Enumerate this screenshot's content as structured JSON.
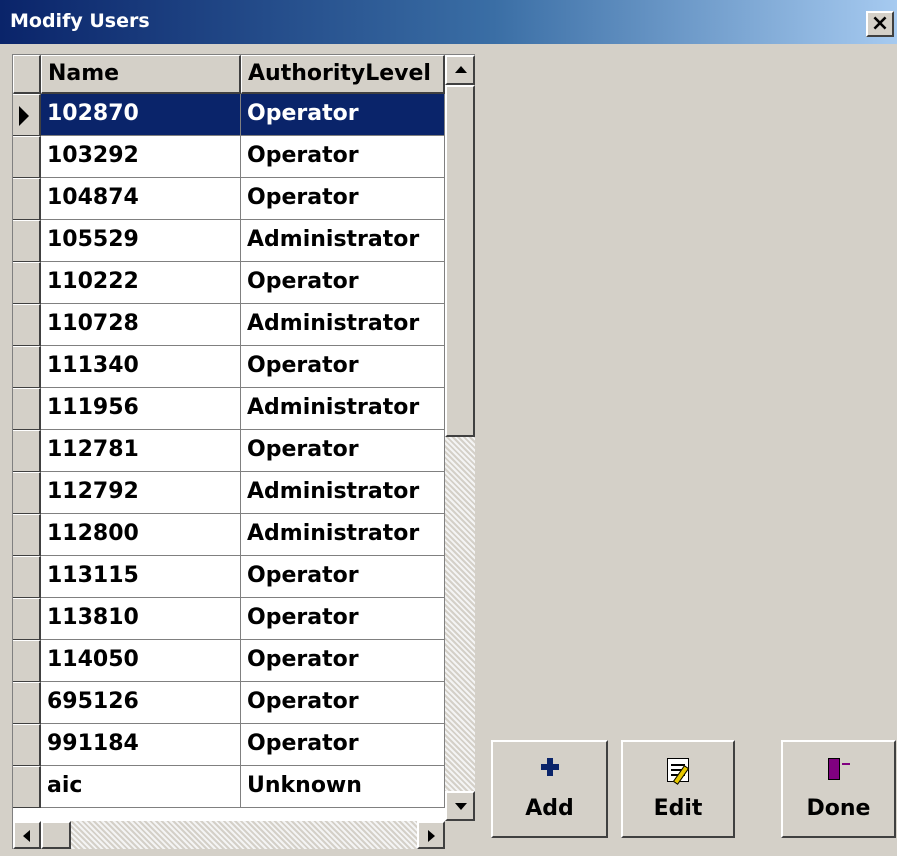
{
  "window": {
    "title": "Modify Users",
    "close_symbol": "×"
  },
  "table": {
    "columns": [
      "Name",
      "AuthorityLevel"
    ],
    "selected_row": 0,
    "rows": [
      {
        "name": "102870",
        "authority": "Operator"
      },
      {
        "name": "103292",
        "authority": "Operator"
      },
      {
        "name": "104874",
        "authority": "Operator"
      },
      {
        "name": "105529",
        "authority": "Administrator"
      },
      {
        "name": "110222",
        "authority": "Operator"
      },
      {
        "name": "110728",
        "authority": "Administrator"
      },
      {
        "name": "111340",
        "authority": "Operator"
      },
      {
        "name": "111956",
        "authority": "Administrator"
      },
      {
        "name": "112781",
        "authority": "Operator"
      },
      {
        "name": "112792",
        "authority": "Administrator"
      },
      {
        "name": "112800",
        "authority": "Administrator"
      },
      {
        "name": "113115",
        "authority": "Operator"
      },
      {
        "name": "113810",
        "authority": "Operator"
      },
      {
        "name": "114050",
        "authority": "Operator"
      },
      {
        "name": "695126",
        "authority": "Operator"
      },
      {
        "name": "991184",
        "authority": "Operator"
      },
      {
        "name": "aic",
        "authority": "Unknown"
      }
    ]
  },
  "buttons": {
    "add": {
      "label": "Add",
      "icon": "plus-icon"
    },
    "edit": {
      "label": "Edit",
      "icon": "edit-document-icon"
    },
    "done": {
      "label": "Done",
      "icon": "exit-door-icon"
    }
  },
  "colors": {
    "title_start": "#0a246a",
    "title_end": "#a6caf0",
    "selection": "#0a246a",
    "face": "#d4d0c8"
  }
}
